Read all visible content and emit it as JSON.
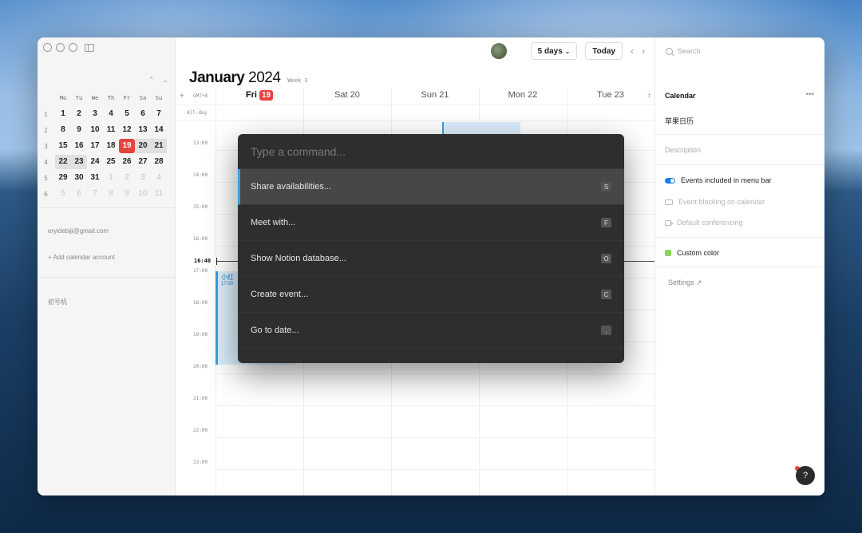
{
  "sidebar": {
    "mini_calendar": {
      "weekdays": [
        "Mo",
        "Tu",
        "We",
        "Th",
        "Fr",
        "Sa",
        "Su"
      ],
      "weeks": [
        {
          "wk": "1",
          "days": [
            "1",
            "2",
            "3",
            "4",
            "5",
            "6",
            "7"
          ]
        },
        {
          "wk": "2",
          "days": [
            "8",
            "9",
            "10",
            "11",
            "12",
            "13",
            "14"
          ]
        },
        {
          "wk": "3",
          "days": [
            "15",
            "16",
            "17",
            "18",
            "19",
            "20",
            "21"
          ]
        },
        {
          "wk": "4",
          "days": [
            "22",
            "23",
            "24",
            "25",
            "26",
            "27",
            "28"
          ]
        },
        {
          "wk": "5",
          "days": [
            "29",
            "30",
            "31",
            "1",
            "2",
            "3",
            "4"
          ]
        },
        {
          "wk": "6",
          "days": [
            "5",
            "6",
            "7",
            "8",
            "9",
            "10",
            "11"
          ]
        }
      ]
    },
    "email": "eryidebiji@gmail.com",
    "add_account": "+ Add calendar account",
    "device_label": "初号机"
  },
  "header": {
    "view_select": "5 days",
    "today_button": "Today",
    "month": "January",
    "year": "2024",
    "week_label": "Week 3",
    "timezone": "GMT+8",
    "add_symbol": "+",
    "all_day": "All-day"
  },
  "days": [
    {
      "name": "Fri",
      "num": "19",
      "current": true
    },
    {
      "name": "Sat",
      "num": "20"
    },
    {
      "name": "Sun",
      "num": "21"
    },
    {
      "name": "Mon",
      "num": "22"
    },
    {
      "name": "Tue",
      "num": "23"
    }
  ],
  "times": [
    "13:00",
    "14:00",
    "15:00",
    "16:00",
    "17:00",
    "18:00",
    "19:00",
    "20:00",
    "21:00",
    "22:00",
    "23:00"
  ],
  "now_time": "16:40",
  "event": {
    "title": "小红",
    "time": "17:00"
  },
  "command_palette": {
    "placeholder": "Type a command...",
    "commands": [
      {
        "label": "Share availabilities...",
        "key": "S"
      },
      {
        "label": "Meet with...",
        "key": "F"
      },
      {
        "label": "Show Notion database...",
        "key": "O"
      },
      {
        "label": "Create event...",
        "key": "C"
      },
      {
        "label": "Go to date...",
        "key": "."
      }
    ]
  },
  "right_panel": {
    "search_placeholder": "Search",
    "section_title": "Calendar",
    "calendar_name": "苹果日历",
    "description_placeholder": "Description",
    "opt_menu_bar": "Events included in menu bar",
    "opt_blocking": "Event blocking on calendar",
    "opt_conferencing": "Default conferencing",
    "opt_color": "Custom color",
    "settings": "Settings",
    "help": "?"
  },
  "colors": {
    "accent": "#1a7fe8",
    "today": "#e5433d",
    "event": "#3b9fe0",
    "custom": "#8dd35a"
  }
}
